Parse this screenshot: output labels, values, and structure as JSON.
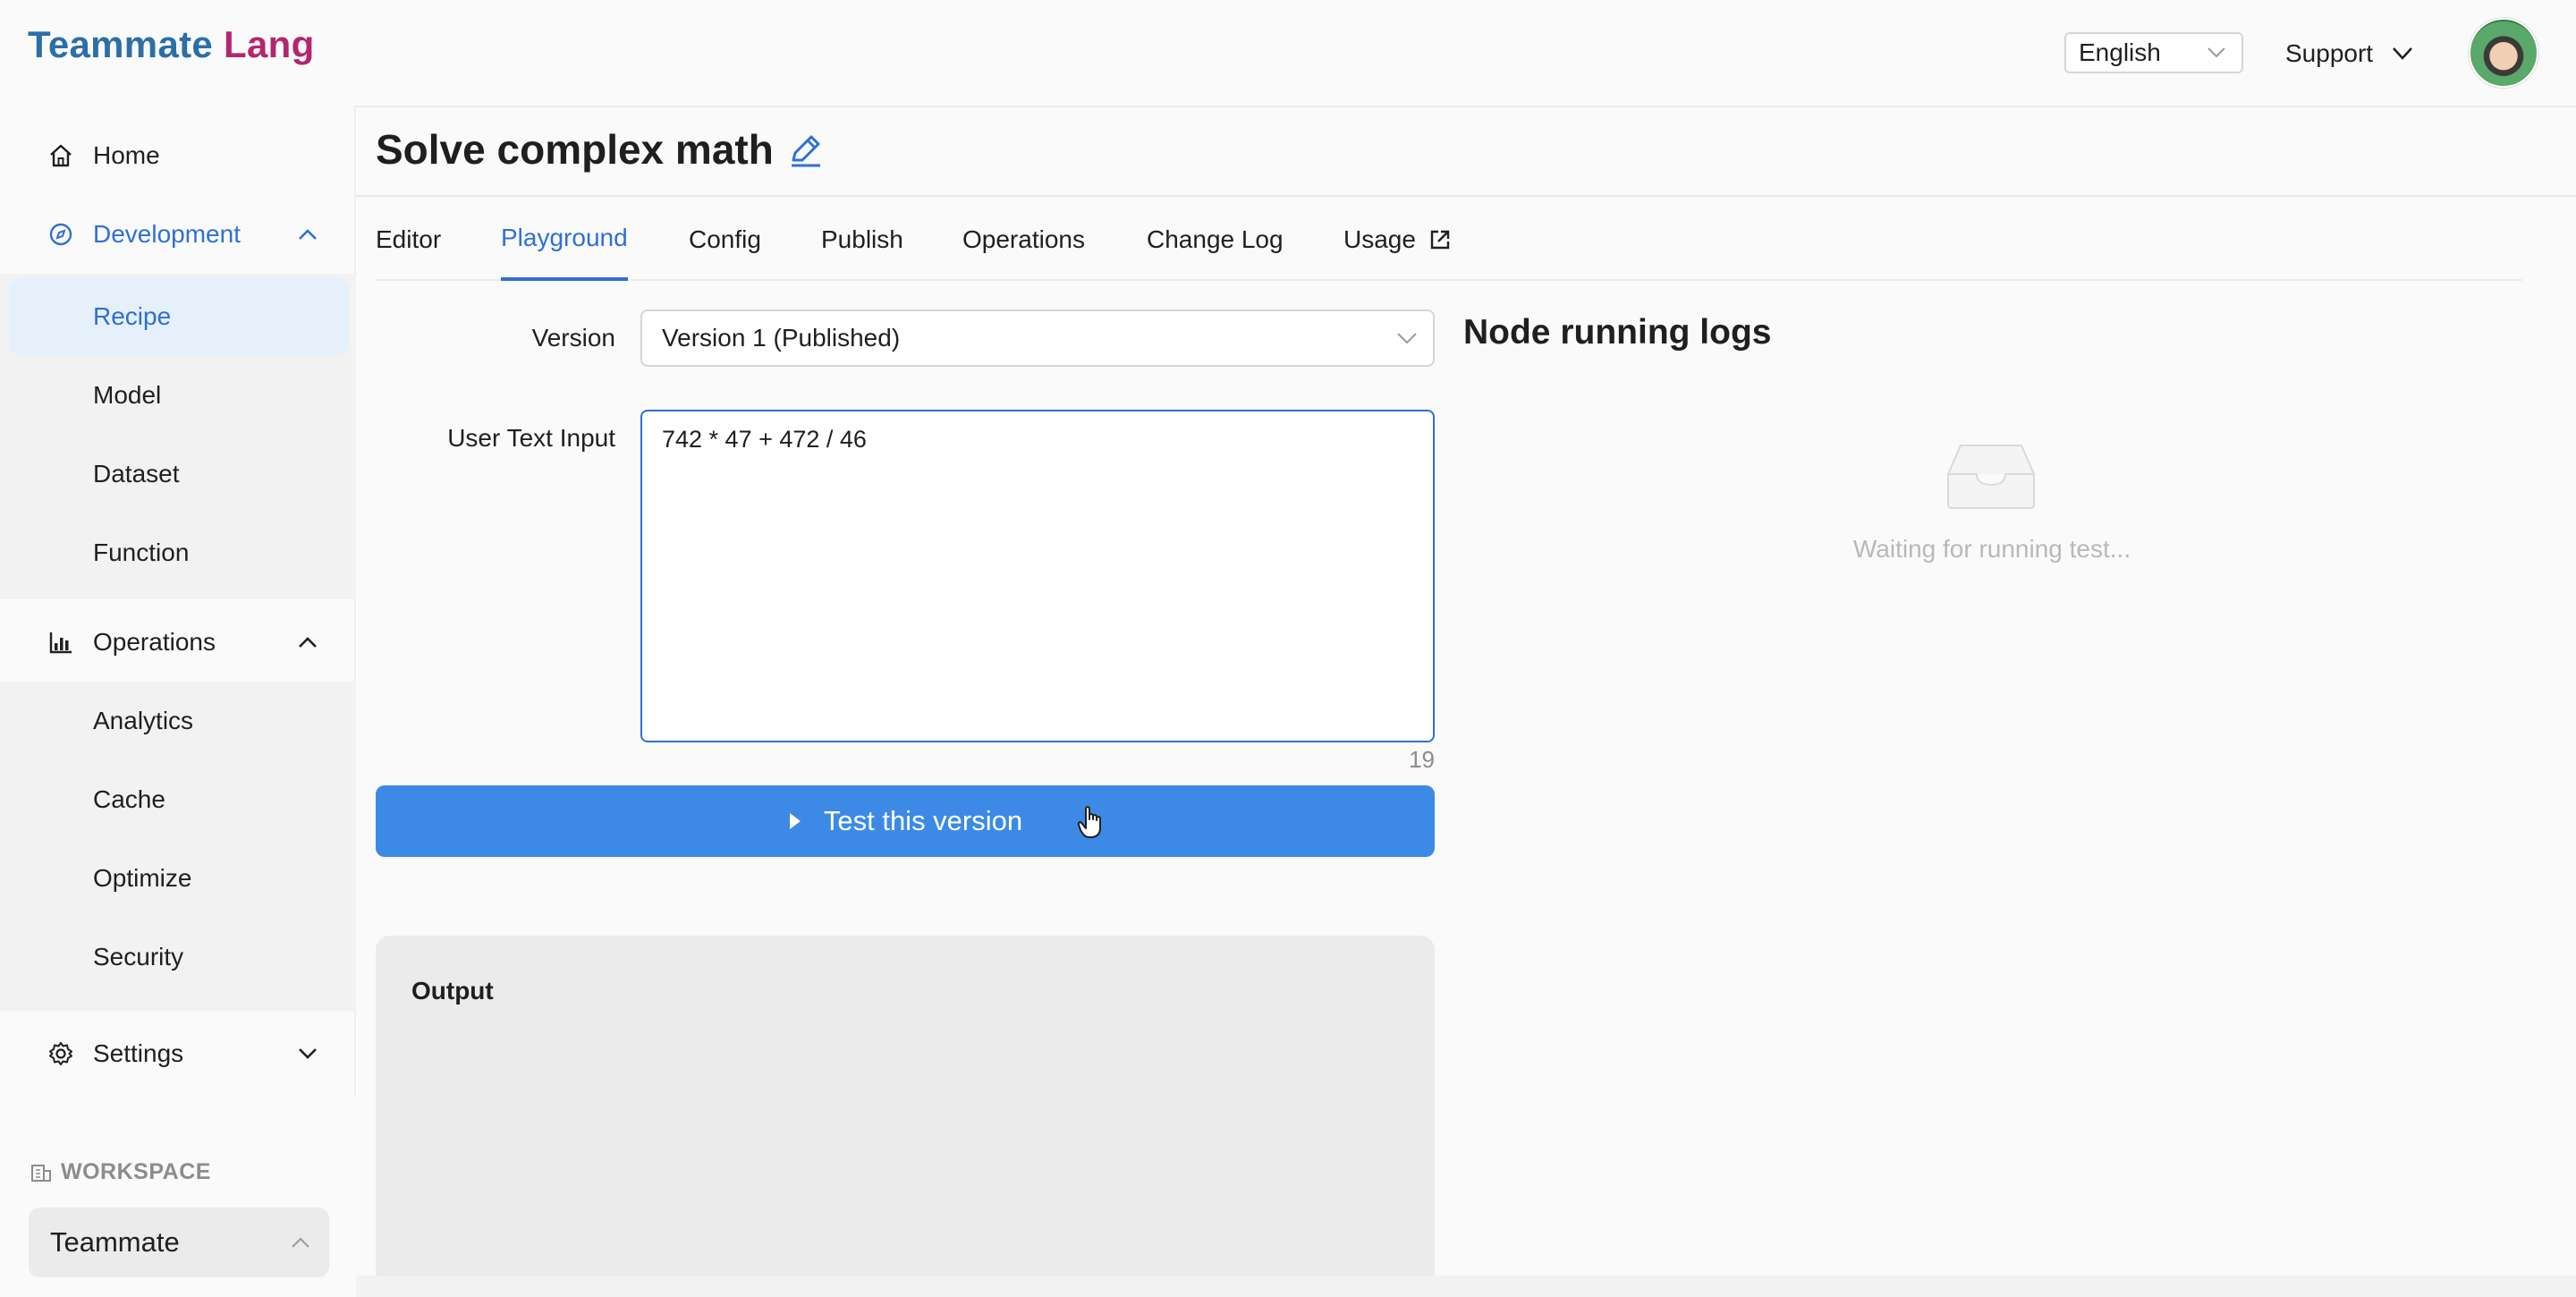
{
  "brand": {
    "part1": "Teammate",
    "part2": "Lang",
    "color1": "#2b6fa8",
    "color2": "#b3266f"
  },
  "topbar": {
    "language": "English",
    "support_label": "Support"
  },
  "sidebar": {
    "home": "Home",
    "development": {
      "label": "Development",
      "items": [
        "Recipe",
        "Model",
        "Dataset",
        "Function"
      ]
    },
    "operations": {
      "label": "Operations",
      "items": [
        "Analytics",
        "Cache",
        "Optimize",
        "Security"
      ]
    },
    "settings": "Settings",
    "workspace_label": "WORKSPACE",
    "workspace_value": "Teammate"
  },
  "page": {
    "title": "Solve complex math"
  },
  "tabs": [
    {
      "label": "Editor"
    },
    {
      "label": "Playground"
    },
    {
      "label": "Config"
    },
    {
      "label": "Publish"
    },
    {
      "label": "Operations"
    },
    {
      "label": "Change Log"
    },
    {
      "label": "Usage"
    }
  ],
  "form": {
    "version_label": "Version",
    "version_value": "Version 1 (Published)",
    "input_label": "User Text Input",
    "input_value": "742 * 47 + 472 / 46",
    "char_count": "19",
    "test_button": "Test this version"
  },
  "output": {
    "title": "Output"
  },
  "logs": {
    "title": "Node running logs",
    "empty_text": "Waiting for running test..."
  },
  "colors": {
    "accent": "#2f6fd6",
    "button": "#3c8ae6"
  }
}
